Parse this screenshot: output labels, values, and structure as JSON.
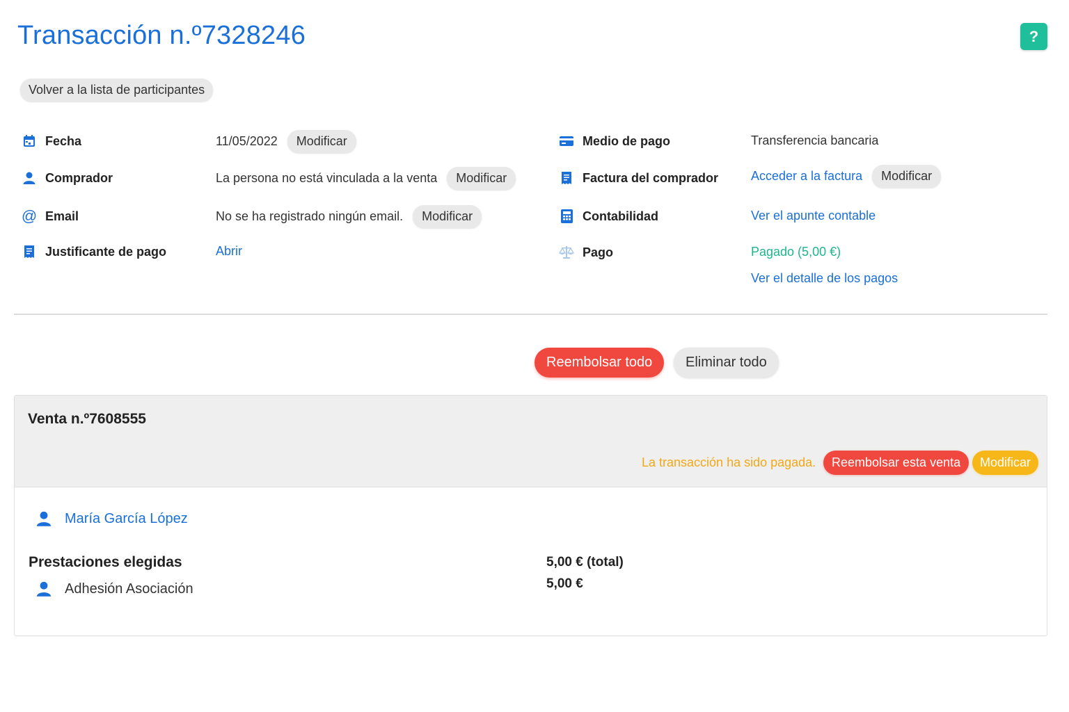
{
  "page": {
    "title": "Transacción n.º7328246",
    "help_label": "?",
    "back_label": "Volver a la lista de participantes"
  },
  "details_left": [
    {
      "icon": "calendar-icon",
      "label": "Fecha",
      "value": "11/05/2022",
      "action": "Modificar"
    },
    {
      "icon": "user-icon",
      "label": "Comprador",
      "value": "La persona no está vinculada a la venta",
      "action": "Modificar"
    },
    {
      "icon": "at-icon",
      "label": "Email",
      "value": "No se ha registrado ningún email.",
      "action": "Modificar"
    },
    {
      "icon": "receipt-icon",
      "label": "Justificante de pago",
      "value": "Abrir"
    }
  ],
  "details_right": [
    {
      "icon": "credit-card-icon",
      "label": "Medio de pago",
      "value": "Transferencia bancaria"
    },
    {
      "icon": "receipt-icon",
      "label": "Factura del comprador",
      "value": "Acceder a la factura",
      "action": "Modificar"
    },
    {
      "icon": "calculator-icon",
      "label": "Contabilidad",
      "value": "Ver el apunte contable"
    },
    {
      "icon": "scale-icon",
      "label": "Pago",
      "value": "Pagado (5,00 €)",
      "value2": "Ver el detalle de los pagos"
    }
  ],
  "actions": {
    "refund_all": "Reembolsar todo",
    "delete_all": "Eliminar todo"
  },
  "sale": {
    "title": "Venta n.º7608555",
    "status": "La transacción ha sido pagada.",
    "refund_label": "Reembolsar esta venta",
    "modify_label": "Modificar",
    "participant": "María García López",
    "services_title": "Prestaciones elegidas",
    "total": "5,00 € (total)",
    "items": [
      {
        "name": "Adhesión Asociación",
        "price": "5,00 €"
      }
    ]
  },
  "colors": {
    "primary": "#1a6fd8",
    "danger": "#f0483e",
    "warning": "#f7b718",
    "success": "#1fb58f",
    "help": "#1fbf9c"
  }
}
